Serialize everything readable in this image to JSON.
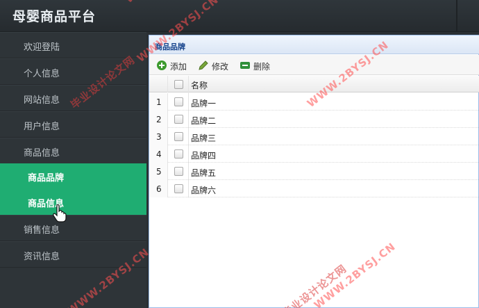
{
  "app": {
    "title": "母婴商品平台"
  },
  "sidebar": {
    "items": [
      {
        "label": "欢迎登陆"
      },
      {
        "label": "个人信息"
      },
      {
        "label": "网站信息"
      },
      {
        "label": "用户信息"
      },
      {
        "label": "商品信息"
      },
      {
        "label": "销售信息"
      },
      {
        "label": "资讯信息"
      }
    ],
    "submenu": [
      {
        "label": "商品品牌"
      },
      {
        "label": "商品信息"
      }
    ]
  },
  "panel": {
    "title": "商品品牌",
    "toolbar": {
      "add_label": "添加",
      "edit_label": "修改",
      "delete_label": "删除"
    },
    "table": {
      "column_name": "名称",
      "rows": [
        {
          "num": "1",
          "name": "品牌一"
        },
        {
          "num": "2",
          "name": "品牌二"
        },
        {
          "num": "3",
          "name": "品牌三"
        },
        {
          "num": "4",
          "name": "品牌四"
        },
        {
          "num": "5",
          "name": "品牌五"
        },
        {
          "num": "6",
          "name": "品牌六"
        }
      ]
    }
  },
  "watermarks": {
    "domain": "WWW.2BYSJ.CN",
    "site_name": "毕业设计论文网"
  },
  "colors": {
    "accent": "#1fad72",
    "sidebar_bg": "#2e3438",
    "header_bg": "#2b3034",
    "panel_title": "#15428b"
  }
}
